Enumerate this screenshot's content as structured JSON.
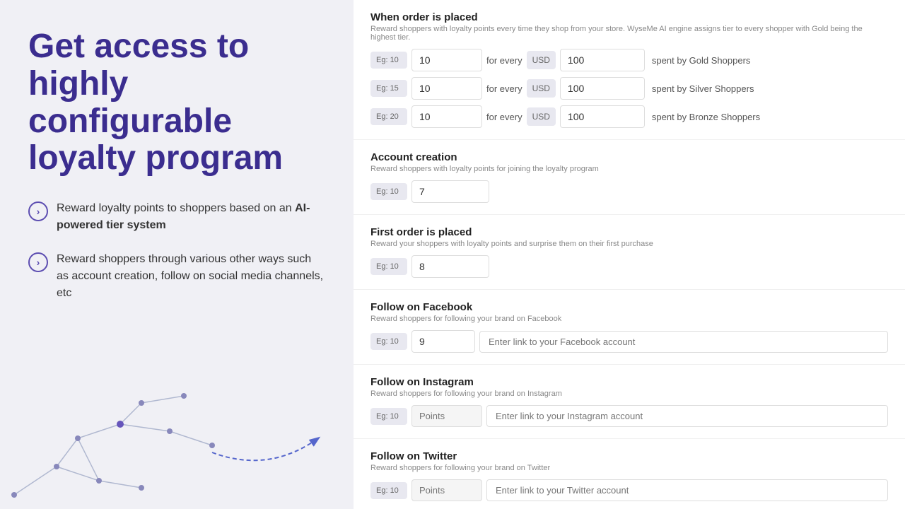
{
  "left": {
    "title": "Get access to highly configurable loyalty program",
    "features": [
      {
        "id": "feature-1",
        "text_normal": "Reward loyalty points to shoppers based on an ",
        "text_bold": "AI-powered tier system"
      },
      {
        "id": "feature-2",
        "text_normal": "Reward shoppers through various other ways such as account creation, follow on social media channels, etc"
      }
    ]
  },
  "right": {
    "sections": [
      {
        "id": "when-order-placed",
        "title": "When order is placed",
        "subtitle": "Reward shoppers with loyalty points every time they shop from your store. WyseMe AI engine assigns tier to every shopper with Gold being the highest tier.",
        "rows": [
          {
            "example": "Eg: 10",
            "points_value": "10",
            "for_every": "for every",
            "currency": "USD",
            "amount_value": "100",
            "tier_label": "spent by Gold Shoppers"
          },
          {
            "example": "Eg: 15",
            "points_value": "10",
            "for_every": "for every",
            "currency": "USD",
            "amount_value": "100",
            "tier_label": "spent by Silver Shoppers"
          },
          {
            "example": "Eg: 20",
            "points_value": "10",
            "for_every": "for every",
            "currency": "USD",
            "amount_value": "100",
            "tier_label": "spent by Bronze Shoppers"
          }
        ]
      },
      {
        "id": "account-creation",
        "title": "Account creation",
        "subtitle": "Reward shoppers with loyalty points for joining the loyalty program",
        "rows": [
          {
            "example": "Eg: 10",
            "points_value": "7"
          }
        ]
      },
      {
        "id": "first-order-placed",
        "title": "First order is placed",
        "subtitle": "Reward your shoppers with loyalty points and surprise them on their first purchase",
        "rows": [
          {
            "example": "Eg: 10",
            "points_value": "8"
          }
        ]
      },
      {
        "id": "follow-facebook",
        "title": "Follow on Facebook",
        "subtitle": "Reward shoppers for following your brand on Facebook",
        "rows": [
          {
            "example": "Eg: 10",
            "points_value": "9",
            "url_placeholder": "Enter link to your Facebook account"
          }
        ]
      },
      {
        "id": "follow-instagram",
        "title": "Follow on Instagram",
        "subtitle": "Reward shoppers for following your brand on Instagram",
        "rows": [
          {
            "example": "Eg: 10",
            "points_value": "",
            "points_placeholder": "Points",
            "url_placeholder": "Enter link to your Instagram account"
          }
        ]
      },
      {
        "id": "follow-twitter",
        "title": "Follow on Twitter",
        "subtitle": "Reward shoppers for following your brand on Twitter",
        "rows": [
          {
            "example": "Eg: 10",
            "points_value": "",
            "points_placeholder": "Points",
            "url_placeholder": "Enter link to your Twitter account"
          }
        ]
      }
    ]
  }
}
